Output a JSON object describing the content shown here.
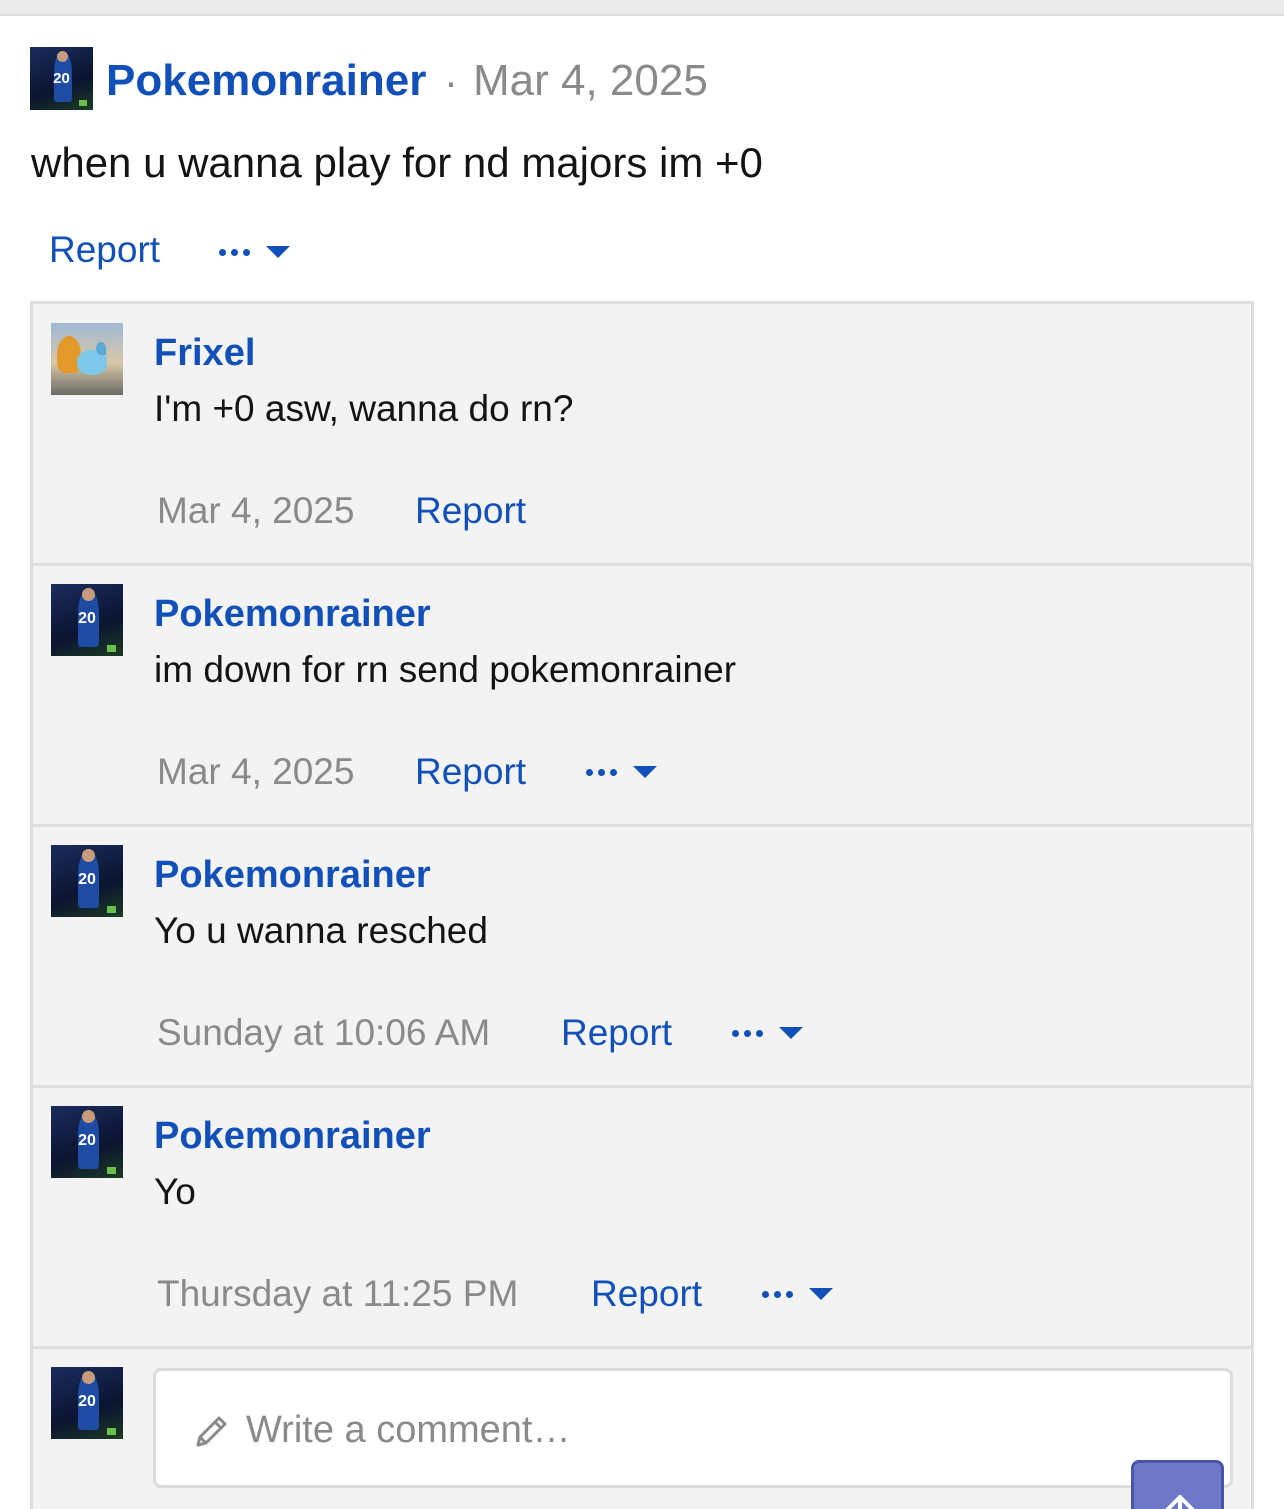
{
  "post": {
    "author": "Pokemonrainer",
    "separator": "·",
    "date": "Mar 4, 2025",
    "text": "when u wanna play for nd majors im +0",
    "report_label": "Report",
    "avatar_number": "20"
  },
  "comments": [
    {
      "author": "Frixel",
      "text": "I'm +0 asw, wanna do rn?",
      "date": "Mar 4, 2025",
      "report_label": "Report",
      "has_more": false
    },
    {
      "author": "Pokemonrainer",
      "text": "im down for rn send pokemonrainer",
      "date": "Mar 4, 2025",
      "report_label": "Report",
      "has_more": true,
      "avatar_number": "20"
    },
    {
      "author": "Pokemonrainer",
      "text": "Yo u wanna resched",
      "date": "Sunday at 10:06 AM",
      "report_label": "Report",
      "has_more": true,
      "avatar_number": "20"
    },
    {
      "author": "Pokemonrainer",
      "text": "Yo",
      "date": "Thursday at 11:25 PM",
      "report_label": "Report",
      "has_more": true,
      "avatar_number": "20"
    }
  ],
  "composer": {
    "placeholder": "Write a comment…",
    "avatar_number": "20"
  },
  "icons": {
    "more": "ellipsis-icon",
    "caret": "caret-down-icon",
    "pencil": "pencil-icon",
    "scroll_top": "arrow-up-icon"
  },
  "colors": {
    "link": "#1050b8",
    "muted": "#8a8a8a",
    "panel": "#f3f3f3",
    "border": "#dedede",
    "scroll_button": "#6f78c6"
  }
}
